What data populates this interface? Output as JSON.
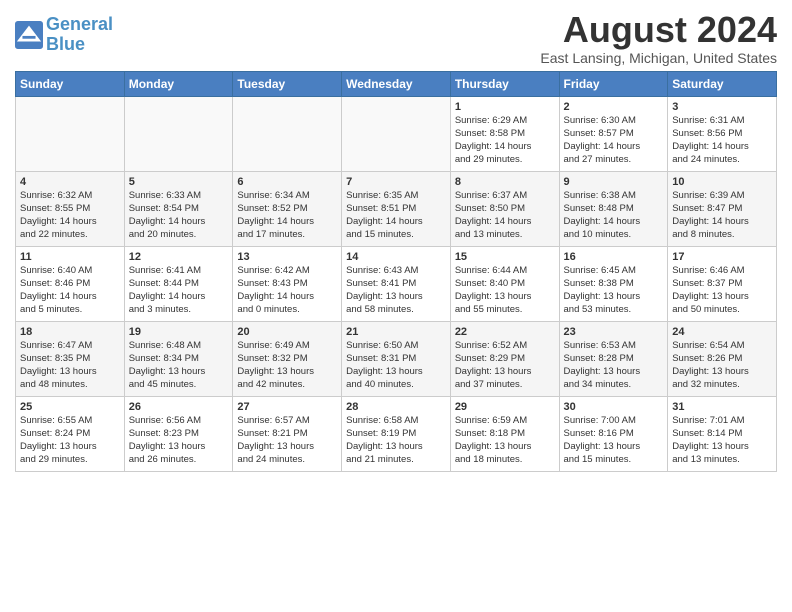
{
  "header": {
    "logo_line1": "General",
    "logo_line2": "Blue",
    "month_year": "August 2024",
    "location": "East Lansing, Michigan, United States"
  },
  "days_of_week": [
    "Sunday",
    "Monday",
    "Tuesday",
    "Wednesday",
    "Thursday",
    "Friday",
    "Saturday"
  ],
  "weeks": [
    [
      {
        "day": "",
        "info": ""
      },
      {
        "day": "",
        "info": ""
      },
      {
        "day": "",
        "info": ""
      },
      {
        "day": "",
        "info": ""
      },
      {
        "day": "1",
        "info": "Sunrise: 6:29 AM\nSunset: 8:58 PM\nDaylight: 14 hours\nand 29 minutes."
      },
      {
        "day": "2",
        "info": "Sunrise: 6:30 AM\nSunset: 8:57 PM\nDaylight: 14 hours\nand 27 minutes."
      },
      {
        "day": "3",
        "info": "Sunrise: 6:31 AM\nSunset: 8:56 PM\nDaylight: 14 hours\nand 24 minutes."
      }
    ],
    [
      {
        "day": "4",
        "info": "Sunrise: 6:32 AM\nSunset: 8:55 PM\nDaylight: 14 hours\nand 22 minutes."
      },
      {
        "day": "5",
        "info": "Sunrise: 6:33 AM\nSunset: 8:54 PM\nDaylight: 14 hours\nand 20 minutes."
      },
      {
        "day": "6",
        "info": "Sunrise: 6:34 AM\nSunset: 8:52 PM\nDaylight: 14 hours\nand 17 minutes."
      },
      {
        "day": "7",
        "info": "Sunrise: 6:35 AM\nSunset: 8:51 PM\nDaylight: 14 hours\nand 15 minutes."
      },
      {
        "day": "8",
        "info": "Sunrise: 6:37 AM\nSunset: 8:50 PM\nDaylight: 14 hours\nand 13 minutes."
      },
      {
        "day": "9",
        "info": "Sunrise: 6:38 AM\nSunset: 8:48 PM\nDaylight: 14 hours\nand 10 minutes."
      },
      {
        "day": "10",
        "info": "Sunrise: 6:39 AM\nSunset: 8:47 PM\nDaylight: 14 hours\nand 8 minutes."
      }
    ],
    [
      {
        "day": "11",
        "info": "Sunrise: 6:40 AM\nSunset: 8:46 PM\nDaylight: 14 hours\nand 5 minutes."
      },
      {
        "day": "12",
        "info": "Sunrise: 6:41 AM\nSunset: 8:44 PM\nDaylight: 14 hours\nand 3 minutes."
      },
      {
        "day": "13",
        "info": "Sunrise: 6:42 AM\nSunset: 8:43 PM\nDaylight: 14 hours\nand 0 minutes."
      },
      {
        "day": "14",
        "info": "Sunrise: 6:43 AM\nSunset: 8:41 PM\nDaylight: 13 hours\nand 58 minutes."
      },
      {
        "day": "15",
        "info": "Sunrise: 6:44 AM\nSunset: 8:40 PM\nDaylight: 13 hours\nand 55 minutes."
      },
      {
        "day": "16",
        "info": "Sunrise: 6:45 AM\nSunset: 8:38 PM\nDaylight: 13 hours\nand 53 minutes."
      },
      {
        "day": "17",
        "info": "Sunrise: 6:46 AM\nSunset: 8:37 PM\nDaylight: 13 hours\nand 50 minutes."
      }
    ],
    [
      {
        "day": "18",
        "info": "Sunrise: 6:47 AM\nSunset: 8:35 PM\nDaylight: 13 hours\nand 48 minutes."
      },
      {
        "day": "19",
        "info": "Sunrise: 6:48 AM\nSunset: 8:34 PM\nDaylight: 13 hours\nand 45 minutes."
      },
      {
        "day": "20",
        "info": "Sunrise: 6:49 AM\nSunset: 8:32 PM\nDaylight: 13 hours\nand 42 minutes."
      },
      {
        "day": "21",
        "info": "Sunrise: 6:50 AM\nSunset: 8:31 PM\nDaylight: 13 hours\nand 40 minutes."
      },
      {
        "day": "22",
        "info": "Sunrise: 6:52 AM\nSunset: 8:29 PM\nDaylight: 13 hours\nand 37 minutes."
      },
      {
        "day": "23",
        "info": "Sunrise: 6:53 AM\nSunset: 8:28 PM\nDaylight: 13 hours\nand 34 minutes."
      },
      {
        "day": "24",
        "info": "Sunrise: 6:54 AM\nSunset: 8:26 PM\nDaylight: 13 hours\nand 32 minutes."
      }
    ],
    [
      {
        "day": "25",
        "info": "Sunrise: 6:55 AM\nSunset: 8:24 PM\nDaylight: 13 hours\nand 29 minutes."
      },
      {
        "day": "26",
        "info": "Sunrise: 6:56 AM\nSunset: 8:23 PM\nDaylight: 13 hours\nand 26 minutes."
      },
      {
        "day": "27",
        "info": "Sunrise: 6:57 AM\nSunset: 8:21 PM\nDaylight: 13 hours\nand 24 minutes."
      },
      {
        "day": "28",
        "info": "Sunrise: 6:58 AM\nSunset: 8:19 PM\nDaylight: 13 hours\nand 21 minutes."
      },
      {
        "day": "29",
        "info": "Sunrise: 6:59 AM\nSunset: 8:18 PM\nDaylight: 13 hours\nand 18 minutes."
      },
      {
        "day": "30",
        "info": "Sunrise: 7:00 AM\nSunset: 8:16 PM\nDaylight: 13 hours\nand 15 minutes."
      },
      {
        "day": "31",
        "info": "Sunrise: 7:01 AM\nSunset: 8:14 PM\nDaylight: 13 hours\nand 13 minutes."
      }
    ]
  ]
}
